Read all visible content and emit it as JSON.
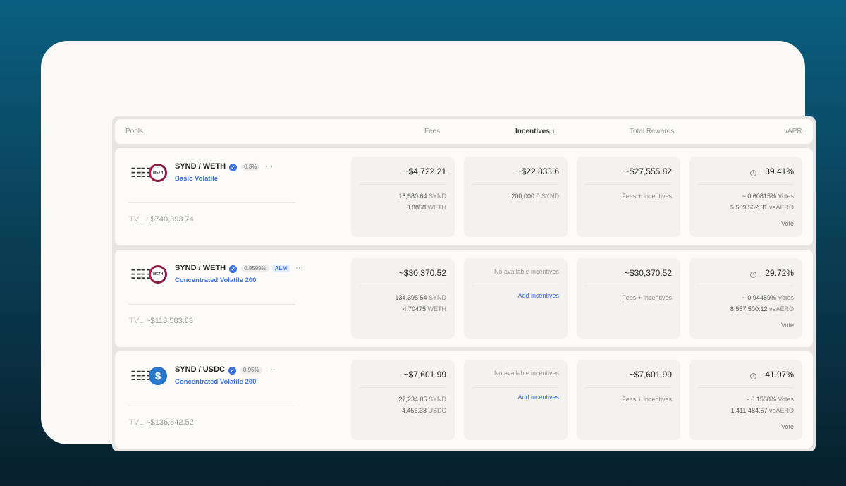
{
  "header": {
    "pools": "Pools",
    "fees": "Fees",
    "incentives": "Incentives ↓",
    "total_rewards": "Total Rewards",
    "vapr": "vAPR"
  },
  "rows": [
    {
      "pair": "SYND / WETH",
      "fee": "0.3%",
      "alm": "",
      "type": "Basic Volatile",
      "tvl_label": "TVL",
      "tvl": "~$740,393.74",
      "token2": "WETH",
      "fees_total": "~$4,722.21",
      "fees_a": "16,580.64",
      "fees_a_sym": "SYND",
      "fees_b": "0.8858",
      "fees_b_sym": "WETH",
      "inc_total": "~$22,833.6",
      "inc_a": "200,000.0",
      "inc_a_sym": "SYND",
      "inc_link": "",
      "rewards_total": "~$27,555.82",
      "rewards_sub": "Fees + Incentives",
      "vapr": "39.41%",
      "votes_pct": "~ 0.60815%",
      "votes_label": "Votes",
      "veaero": "5,509,562.31",
      "veaero_label": "veAERO",
      "vote": "Vote"
    },
    {
      "pair": "SYND / WETH",
      "fee": "0.9599%",
      "alm": "ALM",
      "type": "Concentrated Volatile 200",
      "tvl_label": "TVL",
      "tvl": "~$118,583.63",
      "token2": "WETH",
      "fees_total": "~$30,370.52",
      "fees_a": "134,395.54",
      "fees_a_sym": "SYND",
      "fees_b": "4.70475",
      "fees_b_sym": "WETH",
      "inc_total": "No available incentives",
      "inc_link": "Add incentives",
      "rewards_total": "~$30,370.52",
      "rewards_sub": "Fees + Incentives",
      "vapr": "29.72%",
      "votes_pct": "~ 0.94459%",
      "votes_label": "Votes",
      "veaero": "8,557,500.12",
      "veaero_label": "veAERO",
      "vote": "Vote"
    },
    {
      "pair": "SYND / USDC",
      "fee": "0.95%",
      "alm": "",
      "type": "Concentrated Volatile 200",
      "tvl_label": "TVL",
      "tvl": "~$136,842.52",
      "token2": "USDC",
      "fees_total": "~$7,601.99",
      "fees_a": "27,234.05",
      "fees_a_sym": "SYND",
      "fees_b": "4,456.38",
      "fees_b_sym": "USDC",
      "inc_total": "No available incentives",
      "inc_link": "Add incentives",
      "rewards_total": "~$7,601.99",
      "rewards_sub": "Fees + Incentives",
      "vapr": "41.97%",
      "votes_pct": "~ 0.1558%",
      "votes_label": "Votes",
      "veaero": "1,411,484.57",
      "veaero_label": "veAERO",
      "vote": "Vote"
    }
  ]
}
